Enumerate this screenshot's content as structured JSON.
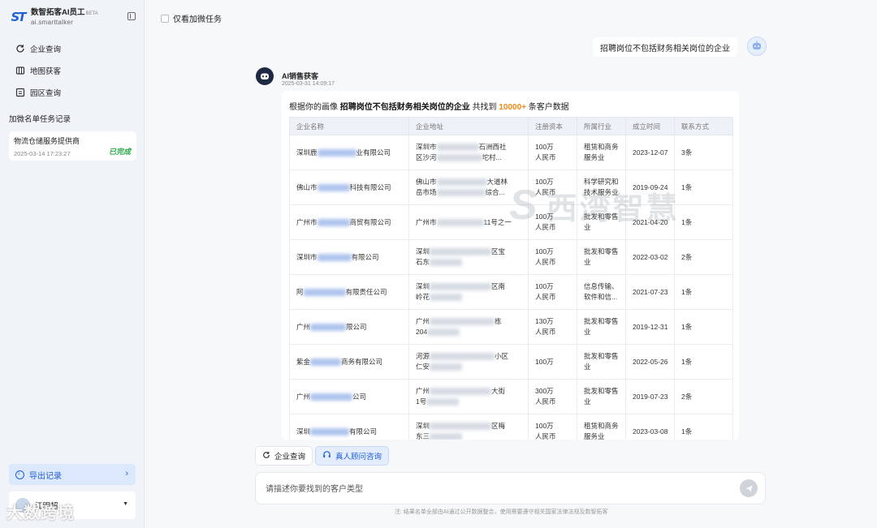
{
  "sidebar": {
    "brand": {
      "name": "数智拓客AI员工",
      "badge": "BETA",
      "domain": "ai.smarttalker",
      "logo_text": "ST"
    },
    "nav": [
      {
        "label": "企业查询",
        "icon": "refresh-search-icon"
      },
      {
        "label": "地图获客",
        "icon": "map-icon"
      },
      {
        "label": "园区查询",
        "icon": "park-icon"
      }
    ],
    "section_title": "加微名单任务记录",
    "tasks": [
      {
        "name": "物流仓储服务提供商",
        "time": "2025-03-14 17:23:27",
        "status": "已完成"
      }
    ],
    "export_label": "导出记录",
    "user": {
      "name": "江明超"
    },
    "watermark": "大数跨境"
  },
  "main": {
    "filter_label": "仅看加微任务",
    "user_message": "招聘岗位不包括财务相关岗位的企业",
    "bot": {
      "name": "AI销售获客",
      "time": "2025-03-31 14:09:17",
      "summary_prefix": "根据你的画像",
      "summary_query": "招聘岗位不包括财务相关岗位的企业",
      "summary_mid": "共找到",
      "summary_count": "10000+",
      "summary_suffix": "条客户数据"
    },
    "table": {
      "headers": [
        "企业名称",
        "企业地址",
        "注册资本",
        "所属行业",
        "成立时间",
        "联系方式"
      ],
      "rows": [
        {
          "name_pre": "深圳鹿",
          "name_post": "业有限公司",
          "addr_pre": "深圳市",
          "addr_post": "石洲西社",
          "addr2_pre": "区沙河",
          "addr2_post": "坨村...",
          "capital": "100万",
          "capital_unit": "人民币",
          "industry": "租赁和商务服务业",
          "date": "2023-12-07",
          "contact": "3条"
        },
        {
          "name_pre": "佛山市",
          "name_post": "科技有限公司",
          "addr_pre": "佛山市",
          "addr_post": "大道林",
          "addr2_pre": "岳市场",
          "addr2_post": "综合...",
          "capital": "100万",
          "capital_unit": "人民币",
          "industry": "科学研究和技术服务业",
          "date": "2019-09-24",
          "contact": "1条"
        },
        {
          "name_pre": "广州市",
          "name_post": "商贸有限公司",
          "addr_pre": "广州市",
          "addr_post": "11号之一",
          "addr2_pre": "",
          "addr2_post": "",
          "capital": "100万",
          "capital_unit": "人民币",
          "industry": "批发和零售业",
          "date": "2021-04-20",
          "contact": "1条"
        },
        {
          "name_pre": "深圳市",
          "name_post": "有限公司",
          "addr_pre": "深圳",
          "addr_post": "区宝",
          "addr2_pre": "石东",
          "addr2_post": "",
          "capital": "100万",
          "capital_unit": "人民币",
          "industry": "批发和零售业",
          "date": "2022-03-02",
          "contact": "2条"
        },
        {
          "name_pre": "阿",
          "name_post": "有限责任公司",
          "addr_pre": "深圳",
          "addr_post": "区南",
          "addr2_pre": "岭花",
          "addr2_post": "",
          "capital": "100万",
          "capital_unit": "人民币",
          "industry": "信息传输、软件和信...",
          "date": "2021-07-23",
          "contact": "1条"
        },
        {
          "name_pre": "广州",
          "name_post": "限公司",
          "addr_pre": "广州",
          "addr_post": "栋",
          "addr2_pre": "204",
          "addr2_post": "",
          "capital": "130万",
          "capital_unit": "人民币",
          "industry": "批发和零售业",
          "date": "2019-12-31",
          "contact": "1条"
        },
        {
          "name_pre": "紫金",
          "name_post": "商务有限公司",
          "addr_pre": "河源",
          "addr_post": "小区",
          "addr2_pre": "仁安",
          "addr2_post": "",
          "capital": "100万",
          "capital_unit": "",
          "industry": "批发和零售业",
          "date": "2022-05-26",
          "contact": "1条"
        },
        {
          "name_pre": "广州",
          "name_post": "公司",
          "addr_pre": "广州",
          "addr_post": "大街",
          "addr2_pre": "1号",
          "addr2_post": "",
          "capital": "300万",
          "capital_unit": "人民币",
          "industry": "批发和零售业",
          "date": "2019-07-23",
          "contact": "2条"
        },
        {
          "name_pre": "深圳",
          "name_post": "有限公司",
          "addr_pre": "深圳",
          "addr_post": "区梅",
          "addr2_pre": "东三",
          "addr2_post": "",
          "capital": "100万",
          "capital_unit": "人民币",
          "industry": "租赁和商务服务业",
          "date": "2023-03-08",
          "contact": "1条"
        }
      ]
    },
    "watermark": "西湾智慧",
    "chips": [
      {
        "label": "企业查询",
        "icon": "refresh-search-icon"
      },
      {
        "label": "真人顾问咨询",
        "icon": "headset-icon"
      }
    ],
    "input_placeholder": "请描述你要找到的客户类型",
    "disclaimer": "注: 结果名单全部由AI通过公开数据整合，使用需要遵守相关国家法律法规及数智拓客"
  },
  "colors": {
    "accent": "#1f5fd6",
    "highlight": "#f08a16",
    "success": "#2ba84a"
  }
}
